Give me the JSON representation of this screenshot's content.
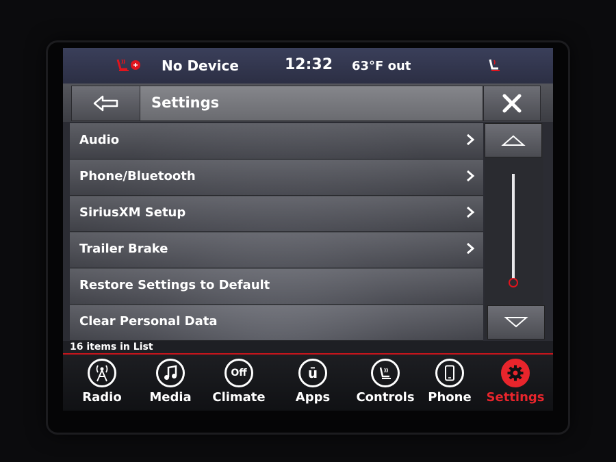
{
  "status": {
    "device": "No Device",
    "clock": "12:32",
    "temperature": "63°F out"
  },
  "header": {
    "title": "Settings"
  },
  "list": {
    "items": [
      {
        "label": "Audio",
        "has_chevron": true
      },
      {
        "label": "Phone/Bluetooth",
        "has_chevron": true
      },
      {
        "label": "SiriusXM Setup",
        "has_chevron": true
      },
      {
        "label": "Trailer Brake",
        "has_chevron": true
      },
      {
        "label": "Restore Settings to Default",
        "has_chevron": false
      },
      {
        "label": "Clear Personal Data",
        "has_chevron": false
      }
    ],
    "count_text": "16 items in List"
  },
  "nav": {
    "items": [
      {
        "label": "Radio",
        "icon": "radio-tower-icon"
      },
      {
        "label": "Media",
        "icon": "music-note-icon"
      },
      {
        "label": "Climate",
        "icon": "climate-off-icon",
        "icon_text": "Off"
      },
      {
        "label": "Apps",
        "icon": "apps-icon",
        "icon_text": "ū"
      },
      {
        "label": "Controls",
        "icon": "controls-icon"
      },
      {
        "label": "Phone",
        "icon": "phone-icon"
      },
      {
        "label": "Settings",
        "icon": "gear-icon",
        "active": true
      }
    ]
  },
  "colors": {
    "accent": "#e8252c",
    "text": "#ffffff",
    "status_bar": "#343852"
  }
}
